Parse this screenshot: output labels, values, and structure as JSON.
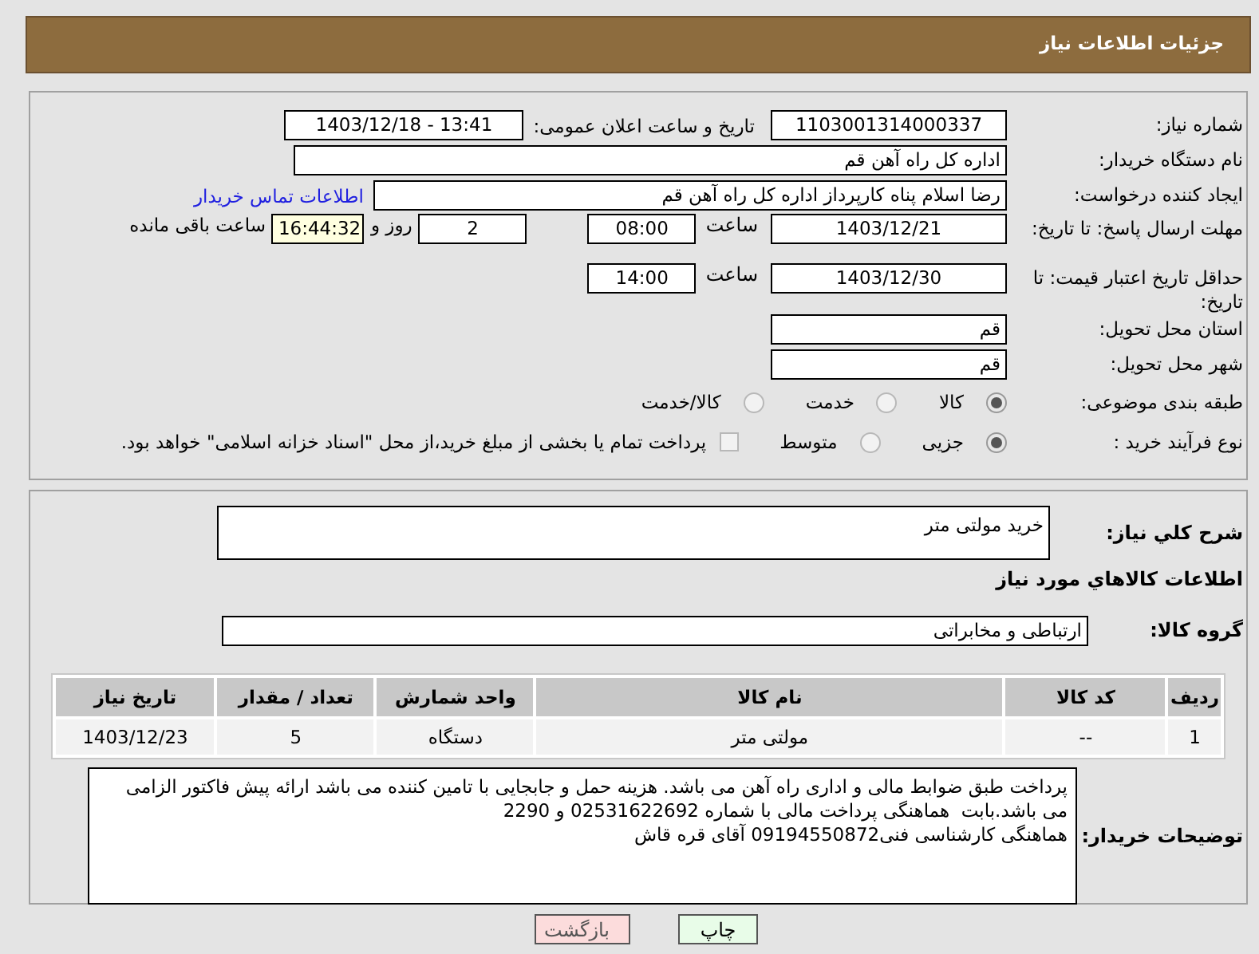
{
  "header": {
    "title": "جزئیات اطلاعات نیاز"
  },
  "need_number": {
    "label": "شماره نیاز:",
    "value": "1103001314000337"
  },
  "announce_datetime": {
    "label": "تاریخ و ساعت اعلان عمومی:",
    "value": "1403/12/18 - 13:41"
  },
  "buyer_org": {
    "label": "نام دستگاه خریدار:",
    "value": "اداره کل  راه آهن قم"
  },
  "requester": {
    "label": "ایجاد کننده درخواست:",
    "value": "رضا اسلام پناه کارپرداز اداره کل  راه آهن قم",
    "link": "اطلاعات تماس خریدار"
  },
  "reply_deadline": {
    "label": "مهلت ارسال پاسخ: تا تاریخ:",
    "date": "1403/12/21",
    "time_label": "ساعت",
    "time": "08:00",
    "days": "2",
    "days_label": "روز و",
    "remaining": "16:44:32",
    "remaining_label": "ساعت باقی مانده"
  },
  "price_validity": {
    "label": "حداقل تاریخ اعتبار قیمت: تا تاریخ:",
    "date": "1403/12/30",
    "time_label": "ساعت",
    "time": "14:00"
  },
  "delivery_province": {
    "label": "استان محل تحویل:",
    "value": "قم"
  },
  "delivery_city": {
    "label": "شهر محل تحویل:",
    "value": "قم"
  },
  "category": {
    "label": "طبقه بندی موضوعی:",
    "options": [
      {
        "label": "کالا",
        "selected": true
      },
      {
        "label": "خدمت",
        "selected": false
      },
      {
        "label": "کالا/خدمت",
        "selected": false
      }
    ]
  },
  "process": {
    "label": "نوع فرآیند خرید :",
    "options": [
      {
        "label": "جزیی",
        "selected": true
      },
      {
        "label": "متوسط",
        "selected": false
      }
    ],
    "payment_note": {
      "label": "پرداخت تمام یا بخشی از مبلغ خرید،از محل \"اسناد خزانه اسلامی\" خواهد بود.",
      "checked": false
    }
  },
  "description": {
    "label": "شرح کلي نياز:",
    "value": "خرید مولتی متر"
  },
  "goods_heading": "اطلاعات کالاهاي مورد نياز",
  "goods_group": {
    "label": "گروه کالا:",
    "value": "ارتباطی و مخابراتی"
  },
  "table": {
    "columns": [
      "ردیف",
      "کد کالا",
      "نام کالا",
      "واحد شمارش",
      "تعداد / مقدار",
      "تاریخ نیاز"
    ],
    "rows": [
      [
        "1",
        "--",
        "مولتی متر",
        "دستگاه",
        "5",
        "1403/12/23"
      ]
    ]
  },
  "buyer_notes": {
    "label": "توضیحات خریدار:",
    "value": "پرداخت طبق ضوابط مالی و اداری راه آهن می باشد. هزینه حمل و جابجایی با تامین کننده می باشد ارائه پیش فاکتور الزامی می باشد.بابت  هماهنگی پرداخت مالی با شماره 02531622692 و 2290\nهماهنگی کارشناسی فنی09194550872 آقای قره قاش"
  },
  "buttons": [
    {
      "label": "چاپ",
      "kind": "print"
    },
    {
      "label": "بازگشت",
      "kind": "back"
    }
  ]
}
